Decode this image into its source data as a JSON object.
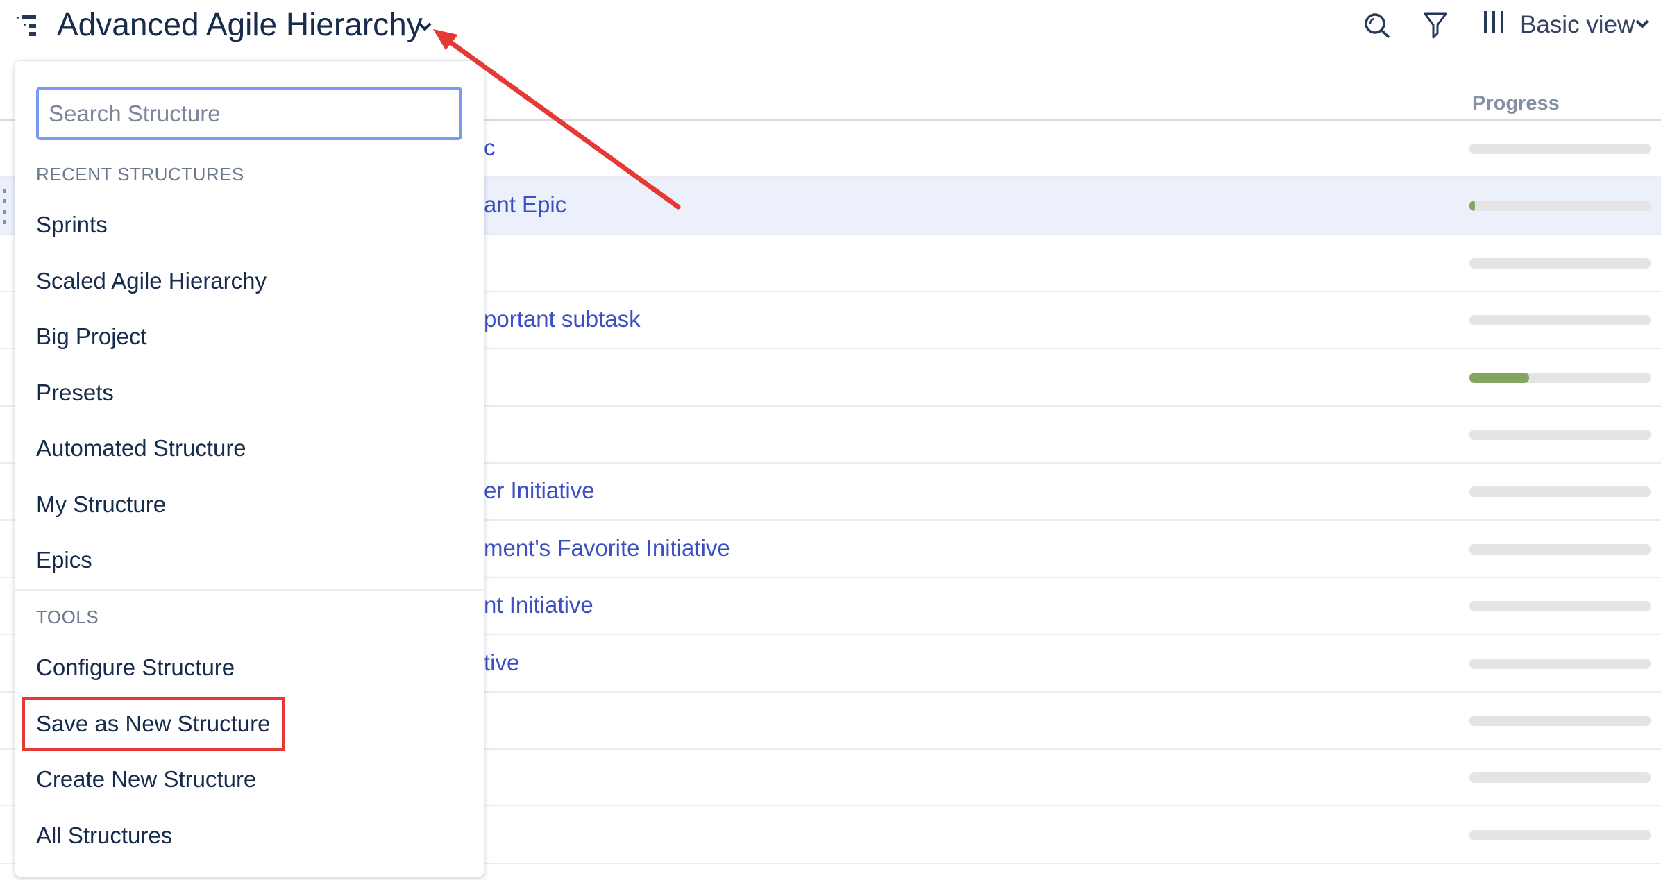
{
  "header": {
    "title": "Advanced Agile Hierarchy",
    "view_label": "Basic view",
    "icons": [
      "structure-icon",
      "chevron-down-icon",
      "search-icon",
      "filter-icon",
      "columns-icon",
      "chevron-down-icon"
    ]
  },
  "table": {
    "progress_header": "Progress",
    "rows": [
      {
        "text": "c",
        "progress": 0,
        "selected": false
      },
      {
        "text": "ant Epic",
        "progress": 3,
        "selected": true
      },
      {
        "text": "",
        "progress": 0,
        "selected": false
      },
      {
        "text": "portant subtask",
        "progress": 0,
        "selected": false
      },
      {
        "text": "",
        "progress": 33,
        "selected": false
      },
      {
        "text": "",
        "progress": 0,
        "selected": false
      },
      {
        "text": "er Initiative",
        "progress": 0,
        "selected": false
      },
      {
        "text": "ment's Favorite Initiative",
        "progress": 0,
        "selected": false
      },
      {
        "text": "nt Initiative",
        "progress": 0,
        "selected": false
      },
      {
        "text": "tive",
        "progress": 0,
        "selected": false
      },
      {
        "text": "",
        "progress": 0,
        "selected": false
      },
      {
        "text": "",
        "progress": 0,
        "selected": false
      },
      {
        "text": "",
        "progress": 0,
        "selected": false
      }
    ]
  },
  "dropdown": {
    "search_placeholder": "Search Structure",
    "search_value": "",
    "recent_header": "RECENT STRUCTURES",
    "recent": [
      "Sprints",
      "Scaled Agile Hierarchy",
      "Big Project",
      "Presets",
      "Automated Structure",
      "My Structure",
      "Epics"
    ],
    "tools_header": "TOOLS",
    "tools": [
      "Configure Structure",
      "Save as New Structure",
      "Create New Structure",
      "All Structures"
    ],
    "highlighted_tool": "Save as New Structure"
  },
  "colors": {
    "accent": "#3b4fc4",
    "progress_fill": "#82a65e",
    "annotation": "#e53935",
    "focus": "#7a9af0"
  }
}
